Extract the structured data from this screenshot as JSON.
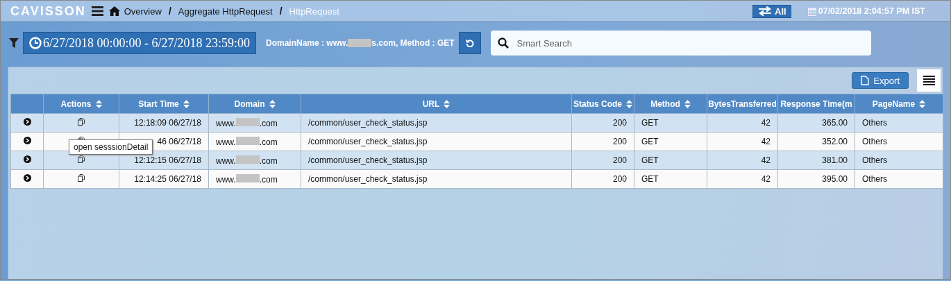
{
  "header": {
    "logo": "CAVISSON",
    "separator": "/",
    "breadcrumbs": [
      {
        "label": "Overview",
        "selected": false
      },
      {
        "label": "Aggregate HttpRequest",
        "selected": false
      },
      {
        "label": "HttpRequest",
        "selected": true
      }
    ],
    "mode_button": "All",
    "datetime": "07/02/2018 2:04:57 PM IST"
  },
  "filter_bar": {
    "time_range": "6/27/2018 00:00:00 - 6/27/2018 23:59:00",
    "filter_before": "DomainName : www.",
    "filter_after": "s.com, Method : GET",
    "search": {
      "placeholder": "Smart Search"
    }
  },
  "table_toolbar": {
    "export_button": "Export"
  },
  "table": {
    "columns": [
      {
        "sortable": false
      },
      {
        "label": "Actions",
        "sortable": true
      },
      {
        "label": "Start Time",
        "sortable": true
      },
      {
        "label": "Domain",
        "sortable": true
      },
      {
        "label": "URL",
        "sortable": true
      },
      {
        "label": "Status Code",
        "sortable": true
      },
      {
        "label": "Method",
        "sortable": true
      },
      {
        "label": "BytesTransferred",
        "sortable": false
      },
      {
        "label": "Response Time(m",
        "sortable": false
      },
      {
        "label": "PageName",
        "sortable": true
      }
    ],
    "rows": [
      {
        "start_time": "12:18:09 06/27/18",
        "domain_before": "www.",
        "domain_after": ".com",
        "url": "/common/user_check_status.jsp",
        "status_code": "200",
        "method": "GET",
        "bytes": "42",
        "response_time": "365.00",
        "page_name": "Others"
      },
      {
        "start_time": "46 06/27/18",
        "domain_before": "www.",
        "domain_after": ".com",
        "url": "/common/user_check_status.jsp",
        "status_code": "200",
        "method": "GET",
        "bytes": "42",
        "response_time": "352.00",
        "page_name": "Others"
      },
      {
        "start_time": "12:12:15 06/27/18",
        "domain_before": "www.",
        "domain_after": ".com",
        "url": "/common/user_check_status.jsp",
        "status_code": "200",
        "method": "GET",
        "bytes": "42",
        "response_time": "381.00",
        "page_name": "Others"
      },
      {
        "start_time": "12:14:25 06/27/18",
        "domain_before": "www.",
        "domain_after": ".com",
        "url": "/common/user_check_status.jsp",
        "status_code": "200",
        "method": "GET",
        "bytes": "42",
        "response_time": "395.00",
        "page_name": "Others"
      }
    ]
  },
  "tooltip": {
    "text": "open sesssionDetail"
  }
}
